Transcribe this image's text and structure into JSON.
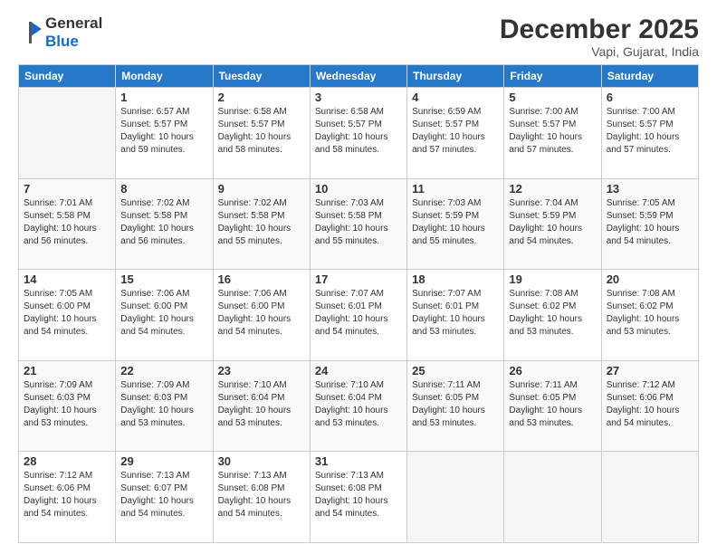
{
  "logo": {
    "general": "General",
    "blue": "Blue"
  },
  "header": {
    "month": "December 2025",
    "location": "Vapi, Gujarat, India"
  },
  "weekdays": [
    "Sunday",
    "Monday",
    "Tuesday",
    "Wednesday",
    "Thursday",
    "Friday",
    "Saturday"
  ],
  "weeks": [
    [
      {
        "day": "",
        "info": ""
      },
      {
        "day": "1",
        "info": "Sunrise: 6:57 AM\nSunset: 5:57 PM\nDaylight: 10 hours\nand 59 minutes."
      },
      {
        "day": "2",
        "info": "Sunrise: 6:58 AM\nSunset: 5:57 PM\nDaylight: 10 hours\nand 58 minutes."
      },
      {
        "day": "3",
        "info": "Sunrise: 6:58 AM\nSunset: 5:57 PM\nDaylight: 10 hours\nand 58 minutes."
      },
      {
        "day": "4",
        "info": "Sunrise: 6:59 AM\nSunset: 5:57 PM\nDaylight: 10 hours\nand 57 minutes."
      },
      {
        "day": "5",
        "info": "Sunrise: 7:00 AM\nSunset: 5:57 PM\nDaylight: 10 hours\nand 57 minutes."
      },
      {
        "day": "6",
        "info": "Sunrise: 7:00 AM\nSunset: 5:57 PM\nDaylight: 10 hours\nand 57 minutes."
      }
    ],
    [
      {
        "day": "7",
        "info": "Sunrise: 7:01 AM\nSunset: 5:58 PM\nDaylight: 10 hours\nand 56 minutes."
      },
      {
        "day": "8",
        "info": "Sunrise: 7:02 AM\nSunset: 5:58 PM\nDaylight: 10 hours\nand 56 minutes."
      },
      {
        "day": "9",
        "info": "Sunrise: 7:02 AM\nSunset: 5:58 PM\nDaylight: 10 hours\nand 55 minutes."
      },
      {
        "day": "10",
        "info": "Sunrise: 7:03 AM\nSunset: 5:58 PM\nDaylight: 10 hours\nand 55 minutes."
      },
      {
        "day": "11",
        "info": "Sunrise: 7:03 AM\nSunset: 5:59 PM\nDaylight: 10 hours\nand 55 minutes."
      },
      {
        "day": "12",
        "info": "Sunrise: 7:04 AM\nSunset: 5:59 PM\nDaylight: 10 hours\nand 54 minutes."
      },
      {
        "day": "13",
        "info": "Sunrise: 7:05 AM\nSunset: 5:59 PM\nDaylight: 10 hours\nand 54 minutes."
      }
    ],
    [
      {
        "day": "14",
        "info": "Sunrise: 7:05 AM\nSunset: 6:00 PM\nDaylight: 10 hours\nand 54 minutes."
      },
      {
        "day": "15",
        "info": "Sunrise: 7:06 AM\nSunset: 6:00 PM\nDaylight: 10 hours\nand 54 minutes."
      },
      {
        "day": "16",
        "info": "Sunrise: 7:06 AM\nSunset: 6:00 PM\nDaylight: 10 hours\nand 54 minutes."
      },
      {
        "day": "17",
        "info": "Sunrise: 7:07 AM\nSunset: 6:01 PM\nDaylight: 10 hours\nand 54 minutes."
      },
      {
        "day": "18",
        "info": "Sunrise: 7:07 AM\nSunset: 6:01 PM\nDaylight: 10 hours\nand 53 minutes."
      },
      {
        "day": "19",
        "info": "Sunrise: 7:08 AM\nSunset: 6:02 PM\nDaylight: 10 hours\nand 53 minutes."
      },
      {
        "day": "20",
        "info": "Sunrise: 7:08 AM\nSunset: 6:02 PM\nDaylight: 10 hours\nand 53 minutes."
      }
    ],
    [
      {
        "day": "21",
        "info": "Sunrise: 7:09 AM\nSunset: 6:03 PM\nDaylight: 10 hours\nand 53 minutes."
      },
      {
        "day": "22",
        "info": "Sunrise: 7:09 AM\nSunset: 6:03 PM\nDaylight: 10 hours\nand 53 minutes."
      },
      {
        "day": "23",
        "info": "Sunrise: 7:10 AM\nSunset: 6:04 PM\nDaylight: 10 hours\nand 53 minutes."
      },
      {
        "day": "24",
        "info": "Sunrise: 7:10 AM\nSunset: 6:04 PM\nDaylight: 10 hours\nand 53 minutes."
      },
      {
        "day": "25",
        "info": "Sunrise: 7:11 AM\nSunset: 6:05 PM\nDaylight: 10 hours\nand 53 minutes."
      },
      {
        "day": "26",
        "info": "Sunrise: 7:11 AM\nSunset: 6:05 PM\nDaylight: 10 hours\nand 53 minutes."
      },
      {
        "day": "27",
        "info": "Sunrise: 7:12 AM\nSunset: 6:06 PM\nDaylight: 10 hours\nand 54 minutes."
      }
    ],
    [
      {
        "day": "28",
        "info": "Sunrise: 7:12 AM\nSunset: 6:06 PM\nDaylight: 10 hours\nand 54 minutes."
      },
      {
        "day": "29",
        "info": "Sunrise: 7:13 AM\nSunset: 6:07 PM\nDaylight: 10 hours\nand 54 minutes."
      },
      {
        "day": "30",
        "info": "Sunrise: 7:13 AM\nSunset: 6:08 PM\nDaylight: 10 hours\nand 54 minutes."
      },
      {
        "day": "31",
        "info": "Sunrise: 7:13 AM\nSunset: 6:08 PM\nDaylight: 10 hours\nand 54 minutes."
      },
      {
        "day": "",
        "info": ""
      },
      {
        "day": "",
        "info": ""
      },
      {
        "day": "",
        "info": ""
      }
    ]
  ]
}
